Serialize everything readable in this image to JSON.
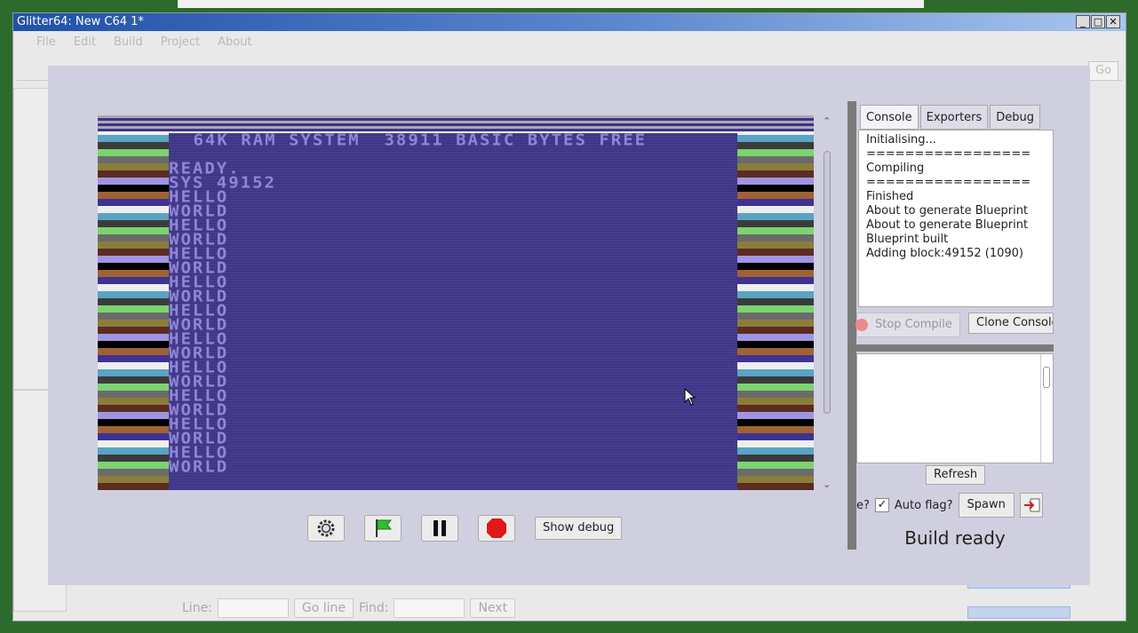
{
  "window": {
    "title": "Glitter64: New C64 1*",
    "controls": [
      "_",
      "□",
      "✕"
    ]
  },
  "menu": [
    "File",
    "Edit",
    "Build",
    "Project",
    "About"
  ],
  "background": {
    "go_label": "Go",
    "findbar": {
      "line_label": "Line:",
      "go_line": "Go line",
      "find_label": "Find:",
      "next": "Next"
    }
  },
  "emulator": {
    "header": " 64K RAM SYSTEM  38911 BASIC BYTES FREE",
    "lines": [
      "READY.",
      "SYS 49152",
      "HELLO",
      "WORLD",
      "HELLO",
      "WORLD",
      "HELLO",
      "WORLD",
      "HELLO",
      "WORLD",
      "HELLO",
      "WORLD",
      "HELLO",
      "WORLD",
      "HELLO",
      "WORLD",
      "HELLO",
      "WORLD",
      "HELLO",
      "WORLD",
      "HELLO",
      "WORLD"
    ]
  },
  "controls": {
    "show_debug": "Show debug"
  },
  "panel": {
    "tabs": [
      "Console",
      "Exporters",
      "Debug"
    ],
    "console_text": "Initialising...\n=================\nCompiling\n=================\nFinished\nAbout to generate Blueprint\nAbout to generate Blueprint\nBlueprint built\nAdding block:49152 (1090)",
    "stop_compile": "Stop Compile",
    "clone_console": "Clone Console",
    "refresh": "Refresh",
    "question_fragment": "e?",
    "auto_flag": "Auto flag?",
    "spawn": "Spawn",
    "status": "Build ready"
  }
}
